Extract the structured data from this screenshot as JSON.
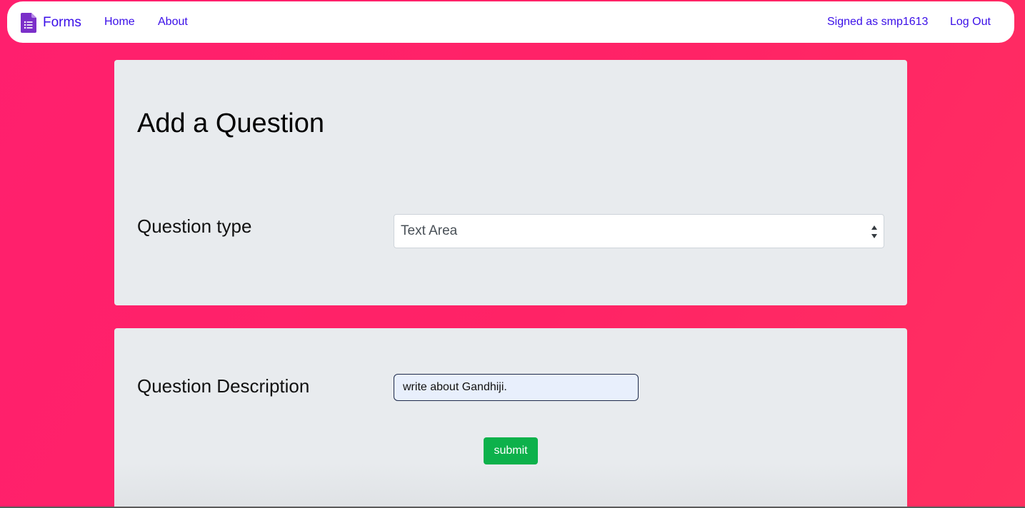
{
  "navbar": {
    "brand": "Forms",
    "links": {
      "home": "Home",
      "about": "About"
    },
    "signed_as": "Signed as smp1613",
    "logout": "Log Out",
    "link_color": "#3a0ee8",
    "brand_icon": "google-forms-icon",
    "brand_icon_color": "#7b2fc9"
  },
  "page": {
    "background_color": "#ff1f6e",
    "card_color": "#e8ebee"
  },
  "question_card": {
    "title": "Add a Question",
    "type_label": "Question type",
    "type_selected": "Text Area",
    "select_icon": "up-down-arrows-icon"
  },
  "description_card": {
    "label": "Question Description",
    "input_value": "write about Gandhiji.",
    "submit_label": "submit",
    "submit_color": "#0db14b"
  }
}
